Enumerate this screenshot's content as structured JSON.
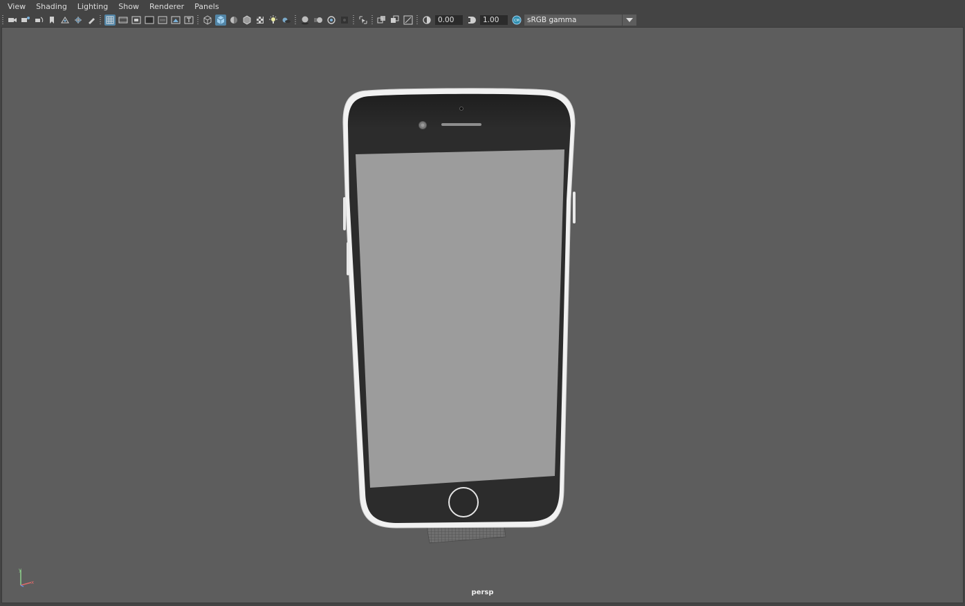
{
  "menu": {
    "items": [
      "View",
      "Shading",
      "Lighting",
      "Show",
      "Renderer",
      "Panels"
    ]
  },
  "toolbar": {
    "groups": [
      [
        "camera-select-icon",
        "camera-attributes-icon",
        "camera-tumble-icon",
        "bookmark-icon",
        "image-plane-icon",
        "two-d-pan-zoom-icon",
        "grease-pencil-icon"
      ],
      [
        "grid-icon",
        "film-gate-icon",
        "resolution-gate-icon",
        "gate-mask-icon",
        "field-chart-icon",
        "safe-action-icon",
        "safe-title-icon"
      ],
      [
        "wireframe-icon",
        "smooth-shade-icon",
        "default-material-icon",
        "wireframe-on-shaded-icon",
        "textured-icon",
        "use-all-lights-icon",
        "shadows-icon"
      ],
      [
        "screen-space-ao-icon",
        "motion-blur-icon",
        "multisample-aa-icon",
        "depth-of-field-icon"
      ],
      [
        "isolate-select-icon"
      ],
      [
        "xray-icon",
        "xray-active-components-icon",
        "xray-joints-icon"
      ]
    ],
    "active_icons": [
      "grid-icon",
      "smooth-shade-icon"
    ],
    "exposure_value": "0.00",
    "gamma_value": "1.00",
    "color_management_label": "sRGB gamma"
  },
  "viewport": {
    "camera_label": "persp",
    "axis_labels": [
      "y",
      "x",
      "z"
    ]
  },
  "colors": {
    "ui_background": "#444444",
    "viewport_background": "#5d5d5d",
    "active_accent": "#5285a6",
    "phone_body": "#2b2b2b",
    "phone_bezel": "#f1f1f1",
    "phone_screen": "#9c9c9c"
  }
}
